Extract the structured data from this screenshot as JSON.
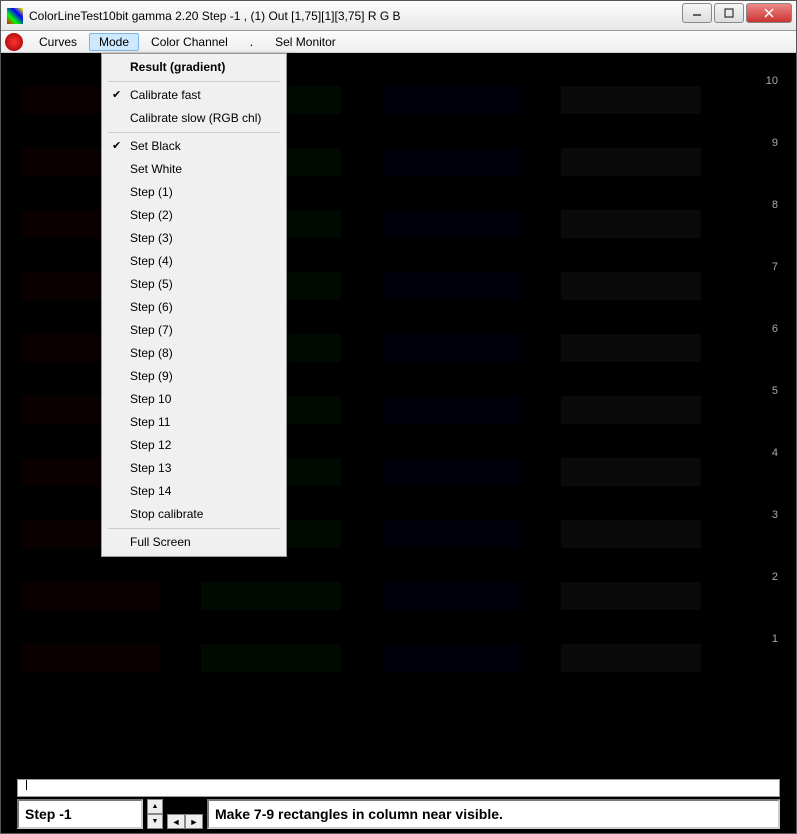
{
  "window": {
    "title": "ColorLineTest10bit gamma 2.20 Step -1 , (1)  Out [1,75][1][3,75]   R G B"
  },
  "menu": {
    "items": [
      "Curves",
      "Mode",
      "Color Channel",
      ".",
      "Sel Monitor"
    ],
    "active_index": 1
  },
  "dropdown": {
    "header": "Result (gradient)",
    "group1": [
      {
        "label": "Calibrate fast",
        "checked": true
      },
      {
        "label": "Calibrate slow (RGB chl)",
        "checked": false
      }
    ],
    "group2": [
      {
        "label": "Set Black",
        "checked": true
      },
      {
        "label": "Set White",
        "checked": false
      },
      {
        "label": "Step (1)",
        "checked": false
      },
      {
        "label": "Step (2)",
        "checked": false
      },
      {
        "label": "Step (3)",
        "checked": false
      },
      {
        "label": "Step (4)",
        "checked": false
      },
      {
        "label": "Step (5)",
        "checked": false
      },
      {
        "label": "Step (6)",
        "checked": false
      },
      {
        "label": "Step (7)",
        "checked": false
      },
      {
        "label": "Step (8)",
        "checked": false
      },
      {
        "label": "Step (9)",
        "checked": false
      },
      {
        "label": "Step 10",
        "checked": false
      },
      {
        "label": "Step 11",
        "checked": false
      },
      {
        "label": "Step 12",
        "checked": false
      },
      {
        "label": "Step 13",
        "checked": false
      },
      {
        "label": "Step 14",
        "checked": false
      },
      {
        "label": "Stop calibrate",
        "checked": false
      }
    ],
    "group3": [
      {
        "label": "Full Screen",
        "checked": false
      }
    ]
  },
  "grid": {
    "row_labels": [
      "10",
      "9",
      "8",
      "7",
      "6",
      "5",
      "4",
      "3",
      "2",
      "1"
    ]
  },
  "status": {
    "step_label": "Step -1",
    "hint": "Make 7-9 rectangles in column near visible."
  },
  "highlight": {
    "group": 1
  }
}
